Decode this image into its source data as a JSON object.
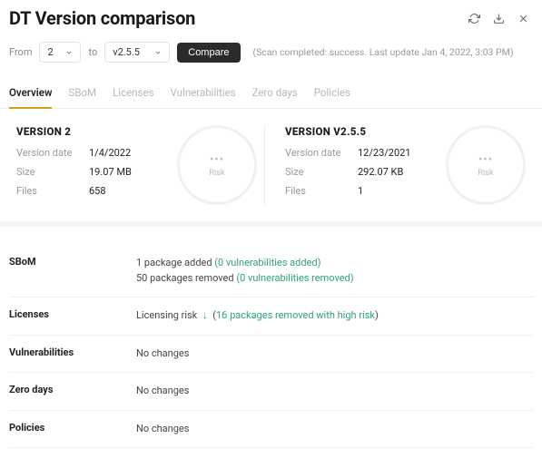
{
  "header": {
    "title": "DT Version comparison"
  },
  "controls": {
    "from_label": "From",
    "from_value": "2",
    "to_label": "to",
    "to_value": "v2.5.5",
    "compare_label": "Compare",
    "scan_status": "(Scan completed: success. Last update Jan 4, 2022, 3:03 PM)"
  },
  "tabs": {
    "overview": "Overview",
    "sbom": "SBoM",
    "licenses": "Licenses",
    "vulnerabilities": "Vulnerabilities",
    "zero_days": "Zero days",
    "policies": "Policies"
  },
  "left": {
    "heading": "VERSION 2",
    "date_label": "Version date",
    "date_value": "1/4/2022",
    "size_label": "Size",
    "size_value": "19.07 MB",
    "files_label": "Files",
    "files_value": "658",
    "risk_label": "Risk",
    "risk_dots": "•••"
  },
  "right": {
    "heading": "VERSION V2.5.5",
    "date_label": "Version date",
    "date_value": "12/23/2021",
    "size_label": "Size",
    "size_value": "292.07 KB",
    "files_label": "Files",
    "files_value": "1",
    "risk_label": "Risk",
    "risk_dots": "•••"
  },
  "summary": {
    "sbom": {
      "label": "SBoM",
      "line1_a": "1 package added ",
      "line1_b": "(0 vulnerabilities added)",
      "line2_a": "50 packages removed ",
      "line2_b": "(0 vulnerabilities removed)"
    },
    "licenses": {
      "label": "Licenses",
      "text_a": "Licensing risk ",
      "arrow": "↓",
      "text_b": " (",
      "link": "16 packages removed with high risk",
      "text_c": ")"
    },
    "vulnerabilities": {
      "label": "Vulnerabilities",
      "text": "No changes"
    },
    "zero_days": {
      "label": "Zero days",
      "text": "No changes"
    },
    "policies": {
      "label": "Policies",
      "text": "No changes"
    }
  }
}
